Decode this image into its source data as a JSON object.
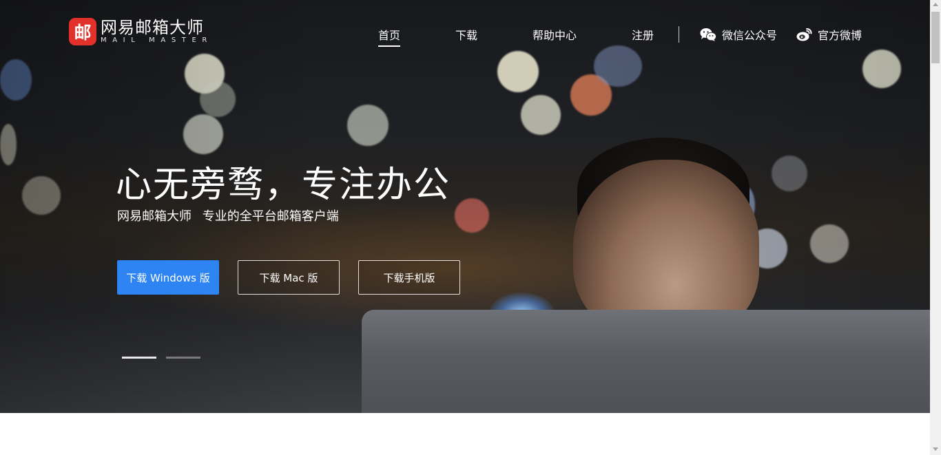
{
  "brand": {
    "mark": "邮",
    "name_cn": "网易邮箱大师",
    "name_en": "MAIL MASTER",
    "color": "#e2312b"
  },
  "nav": {
    "items": [
      {
        "label": "首页",
        "active": true
      },
      {
        "label": "下载",
        "active": false
      },
      {
        "label": "帮助中心",
        "active": false
      },
      {
        "label": "注册",
        "active": false
      }
    ],
    "social": [
      {
        "label": "微信公众号",
        "icon": "wechat-icon"
      },
      {
        "label": "官方微博",
        "icon": "weibo-icon"
      }
    ]
  },
  "hero": {
    "headline": "心无旁骛，专注办公",
    "subline": "网易邮箱大师 专业的全平台邮箱客户端",
    "buttons": [
      {
        "label": "下载 Windows 版",
        "style": "primary"
      },
      {
        "label": "下载 Mac 版",
        "style": "outline"
      },
      {
        "label": "下载手机版",
        "style": "outline"
      }
    ],
    "slides": {
      "count": 2,
      "active": 1
    }
  },
  "colors": {
    "accent": "#2d84f2",
    "brand": "#e2312b"
  }
}
